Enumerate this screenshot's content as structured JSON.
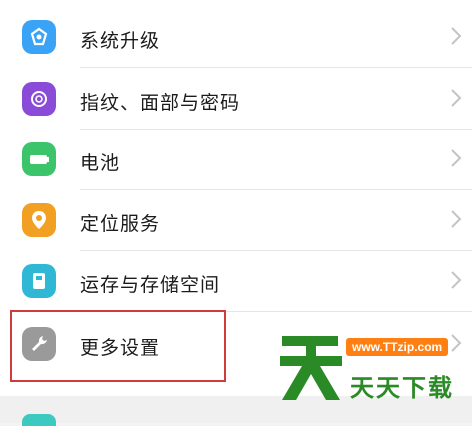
{
  "settings": {
    "items": [
      {
        "label": "系统升级",
        "icon": "system-update-icon",
        "color": "#3aa3f5"
      },
      {
        "label": "指纹、面部与密码",
        "icon": "fingerprint-face-icon",
        "color": "#8a4bd9"
      },
      {
        "label": "电池",
        "icon": "battery-icon",
        "color": "#3cc46b"
      },
      {
        "label": "定位服务",
        "icon": "location-icon",
        "color": "#f2a024"
      },
      {
        "label": "运存与存储空间",
        "icon": "storage-icon",
        "color": "#2fb8d6"
      },
      {
        "label": "更多设置",
        "icon": "wrench-icon",
        "color": "#9a9a9a"
      }
    ]
  },
  "watermark": {
    "url": "www.TTzip.com",
    "name": "天天下载",
    "colors": {
      "green": "#2a8a25",
      "orange": "#ff7f13"
    }
  },
  "accent_highlight": "#cf3c3c"
}
